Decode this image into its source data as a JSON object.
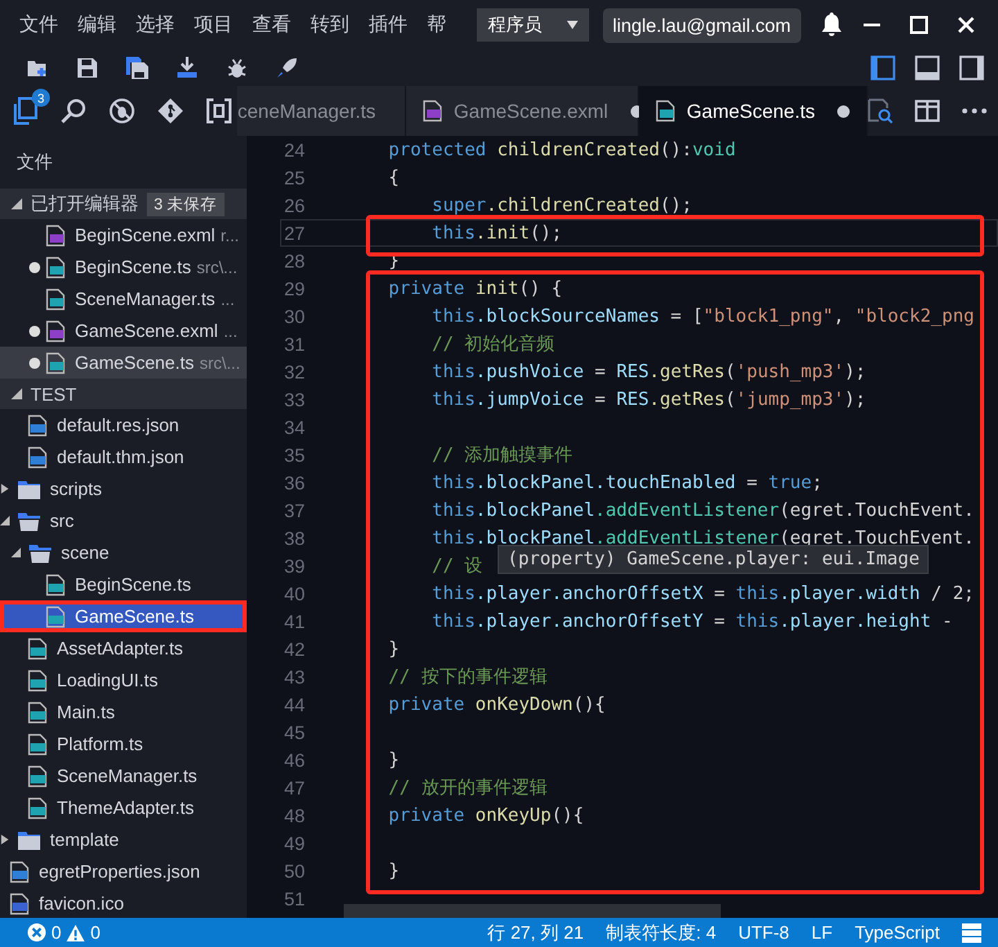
{
  "menu": [
    "文件",
    "编辑",
    "选择",
    "项目",
    "查看",
    "转到",
    "插件",
    "帮"
  ],
  "role_dropdown": {
    "value": "程序员"
  },
  "account": {
    "email": "lingle.lau@gmail.com"
  },
  "layout_buttons": [
    {
      "kind": "left",
      "selected": true
    },
    {
      "kind": "bottom",
      "selected": false
    },
    {
      "kind": "right",
      "selected": false
    }
  ],
  "activity_badge": "3",
  "tabs": [
    {
      "label": "ceneManager.ts",
      "selected": false
    },
    {
      "label": "GameScene.exml",
      "kind": "exml",
      "dirty": true,
      "selected": false
    },
    {
      "label": "GameScene.ts",
      "kind": "ts",
      "dirty": true,
      "selected": true
    }
  ],
  "sidebar": {
    "title": "文件",
    "open_editors": {
      "title": "已打开编辑器",
      "badge": "3 未保存",
      "items": [
        {
          "name": "BeginScene.exml",
          "kind": "exml",
          "description": "r...",
          "dirty": false,
          "selected": false
        },
        {
          "name": "BeginScene.ts",
          "kind": "ts",
          "description": "src\\...",
          "dirty": true,
          "selected": false
        },
        {
          "name": "SceneManager.ts",
          "kind": "ts",
          "description": "...",
          "dirty": false,
          "selected": false
        },
        {
          "name": "GameScene.exml",
          "kind": "exml",
          "description": "...",
          "dirty": true,
          "selected": false
        },
        {
          "name": "GameScene.ts",
          "kind": "ts",
          "description": "src\\...",
          "dirty": true,
          "selected": true
        }
      ]
    },
    "project": {
      "title": "TEST",
      "tree": [
        {
          "children": [
            {
              "name": "default.res.json",
              "kind": "json"
            },
            {
              "name": "default.thm.json",
              "kind": "json"
            }
          ]
        },
        {
          "name": "scripts",
          "kind": "folder",
          "expanded": false
        },
        {
          "name": "src",
          "kind": "folder",
          "expanded": true,
          "children": [
            {
              "name": "scene",
              "kind": "folder",
              "expanded": true,
              "children": [
                {
                  "name": "BeginScene.ts",
                  "kind": "ts",
                  "selected": false
                },
                {
                  "name": "GameScene.ts",
                  "kind": "ts",
                  "selected": true,
                  "highlighted": true
                }
              ]
            },
            {
              "name": "AssetAdapter.ts",
              "kind": "ts"
            },
            {
              "name": "LoadingUI.ts",
              "kind": "ts"
            },
            {
              "name": "Main.ts",
              "kind": "ts"
            },
            {
              "name": "Platform.ts",
              "kind": "ts"
            },
            {
              "name": "SceneManager.ts",
              "kind": "ts"
            },
            {
              "name": "ThemeAdapter.ts",
              "kind": "ts"
            }
          ]
        },
        {
          "name": "template",
          "kind": "folder",
          "expanded": false
        },
        {
          "name": "egretProperties.json",
          "kind": "json"
        },
        {
          "name": "favicon.ico",
          "kind": "file"
        }
      ]
    }
  },
  "editor": {
    "lines": [
      {
        "number": "24",
        "tokens": [
          {
            "kind": "kw",
            "text": "    protected "
          },
          {
            "kind": "fn",
            "text": "childrenCreated"
          },
          {
            "kind": "plain",
            "text": "():"
          },
          {
            "kind": "type",
            "text": "void"
          }
        ]
      },
      {
        "number": "25",
        "tokens": [
          {
            "kind": "plain",
            "text": "    {"
          }
        ]
      },
      {
        "number": "26",
        "tokens": [
          {
            "kind": "kw",
            "text": "        super"
          },
          {
            "kind": "fn",
            "text": ".childrenCreated"
          },
          {
            "kind": "plain",
            "text": "();"
          }
        ]
      },
      {
        "number": "27",
        "current": true,
        "highlighted": true,
        "tokens": [
          {
            "kind": "kw",
            "text": "        this"
          },
          {
            "kind": "fn",
            "text": ".init"
          },
          {
            "kind": "plain",
            "text": "();"
          }
        ]
      },
      {
        "number": "28",
        "tokens": [
          {
            "kind": "plain",
            "text": "    }"
          }
        ]
      },
      {
        "number": "29",
        "highlighted": true,
        "tokens": [
          {
            "kind": "kw",
            "text": "    private "
          },
          {
            "kind": "fn",
            "text": "init"
          },
          {
            "kind": "plain",
            "text": "() {"
          }
        ]
      },
      {
        "number": "30",
        "highlighted": true,
        "tokens": [
          {
            "kind": "kw",
            "text": "        this"
          },
          {
            "kind": "var",
            "text": ".blockSourceNames"
          },
          {
            "kind": "plain",
            "text": " = ["
          },
          {
            "kind": "str",
            "text": "\"block1_png\""
          },
          {
            "kind": "plain",
            "text": ", "
          },
          {
            "kind": "str",
            "text": "\"block2_png"
          }
        ]
      },
      {
        "number": "31",
        "highlighted": true,
        "tokens": [
          {
            "kind": "comment",
            "text": "        // 初始化音频"
          }
        ]
      },
      {
        "number": "32",
        "highlighted": true,
        "tokens": [
          {
            "kind": "kw",
            "text": "        this"
          },
          {
            "kind": "var",
            "text": ".pushVoice"
          },
          {
            "kind": "plain",
            "text": " = "
          },
          {
            "kind": "var",
            "text": "RES"
          },
          {
            "kind": "fn",
            "text": ".getRes"
          },
          {
            "kind": "plain",
            "text": "("
          },
          {
            "kind": "str",
            "text": "'push_mp3'"
          },
          {
            "kind": "plain",
            "text": ");"
          }
        ]
      },
      {
        "number": "33",
        "highlighted": true,
        "tokens": [
          {
            "kind": "kw",
            "text": "        this"
          },
          {
            "kind": "var",
            "text": ".jumpVoice"
          },
          {
            "kind": "plain",
            "text": " = "
          },
          {
            "kind": "var",
            "text": "RES"
          },
          {
            "kind": "fn",
            "text": ".getRes"
          },
          {
            "kind": "plain",
            "text": "("
          },
          {
            "kind": "str",
            "text": "'jump_mp3'"
          },
          {
            "kind": "plain",
            "text": ");"
          }
        ]
      },
      {
        "number": "34",
        "highlighted": true
      },
      {
        "number": "35",
        "highlighted": true,
        "tokens": [
          {
            "kind": "comment",
            "text": "        // 添加触摸事件"
          }
        ]
      },
      {
        "number": "36",
        "highlighted": true,
        "tokens": [
          {
            "kind": "kw",
            "text": "        this"
          },
          {
            "kind": "var",
            "text": ".blockPanel.touchEnabled"
          },
          {
            "kind": "plain",
            "text": " = "
          },
          {
            "kind": "kw",
            "text": "true"
          },
          {
            "kind": "plain",
            "text": ";"
          }
        ]
      },
      {
        "number": "37",
        "highlighted": true,
        "tokens": [
          {
            "kind": "kw",
            "text": "        this"
          },
          {
            "kind": "var",
            "text": ".blockPanel"
          },
          {
            "kind": "type",
            "text": ".addEventListener"
          },
          {
            "kind": "plain",
            "text": "(egret.TouchEvent."
          }
        ]
      },
      {
        "number": "38",
        "highlighted": true,
        "tokens": [
          {
            "kind": "kw",
            "text": "        this"
          },
          {
            "kind": "var",
            "text": ".blockPanel"
          },
          {
            "kind": "type",
            "text": ".addEventListener"
          },
          {
            "kind": "plain",
            "text": "(egret.TouchEvent."
          }
        ]
      },
      {
        "number": "39",
        "highlighted": true,
        "tooltip": "(property) GameScene.player: eui.Image",
        "tokens": [
          {
            "kind": "comment",
            "text": "        // 设"
          }
        ]
      },
      {
        "number": "40",
        "highlighted": true,
        "tokens": [
          {
            "kind": "kw",
            "text": "        this"
          },
          {
            "kind": "var",
            "text": ".player.anchorOffsetX"
          },
          {
            "kind": "plain",
            "text": " = "
          },
          {
            "kind": "kw",
            "text": "this"
          },
          {
            "kind": "var",
            "text": ".player.width"
          },
          {
            "kind": "plain",
            "text": " / 2;"
          }
        ]
      },
      {
        "number": "41",
        "highlighted": true,
        "tokens": [
          {
            "kind": "kw",
            "text": "        this"
          },
          {
            "kind": "var",
            "text": ".player.anchorOffsetY"
          },
          {
            "kind": "plain",
            "text": " = "
          },
          {
            "kind": "kw",
            "text": "this"
          },
          {
            "kind": "var",
            "text": ".player.height"
          },
          {
            "kind": "plain",
            "text": " -"
          }
        ]
      },
      {
        "number": "42",
        "highlighted": true,
        "tokens": [
          {
            "kind": "plain",
            "text": "    }"
          }
        ]
      },
      {
        "number": "43",
        "highlighted": true,
        "tokens": [
          {
            "kind": "comment",
            "text": "    // 按下的事件逻辑"
          }
        ]
      },
      {
        "number": "44",
        "highlighted": true,
        "tokens": [
          {
            "kind": "kw",
            "text": "    private "
          },
          {
            "kind": "fn",
            "text": "onKeyDown"
          },
          {
            "kind": "plain",
            "text": "(){"
          }
        ]
      },
      {
        "number": "45",
        "highlighted": true
      },
      {
        "number": "46",
        "highlighted": true,
        "tokens": [
          {
            "kind": "plain",
            "text": "    }"
          }
        ]
      },
      {
        "number": "47",
        "highlighted": true,
        "tokens": [
          {
            "kind": "comment",
            "text": "    // 放开的事件逻辑"
          }
        ]
      },
      {
        "number": "48",
        "highlighted": true,
        "tokens": [
          {
            "kind": "kw",
            "text": "    private "
          },
          {
            "kind": "fn",
            "text": "onKeyUp"
          },
          {
            "kind": "plain",
            "text": "(){"
          }
        ]
      },
      {
        "number": "49",
        "highlighted": true
      },
      {
        "number": "50",
        "highlighted": true,
        "tokens": [
          {
            "kind": "plain",
            "text": "    }"
          }
        ]
      },
      {
        "number": "51"
      }
    ]
  },
  "status_bar": {
    "errors": "0",
    "warnings": "0",
    "items": [
      "行 27, 列 21",
      "制表符长度: 4",
      "UTF-8",
      "LF",
      "TypeScript"
    ]
  }
}
